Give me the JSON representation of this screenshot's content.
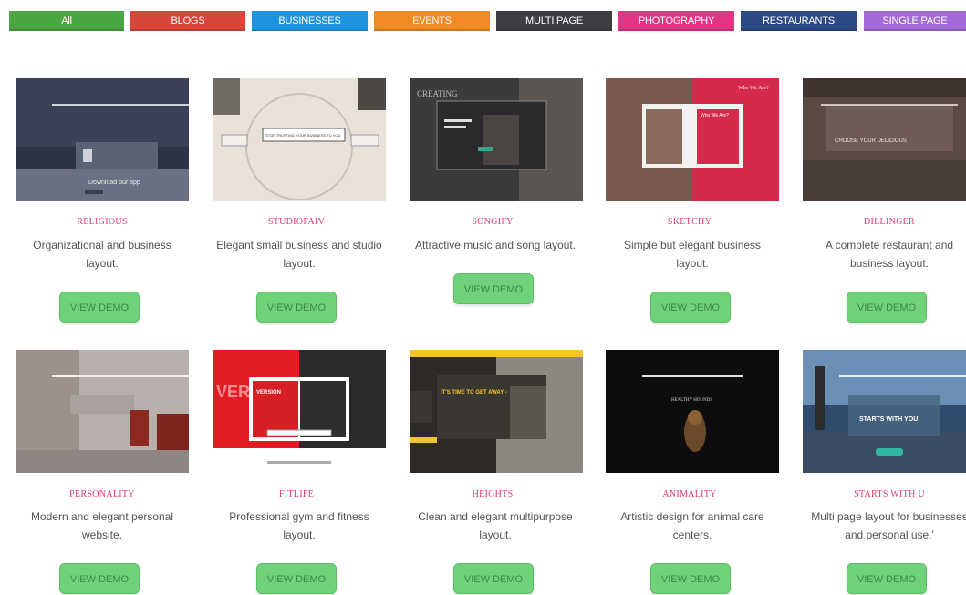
{
  "filters": [
    {
      "label": "All",
      "color": "#49a640"
    },
    {
      "label": "BLOGS",
      "color": "#d9453b"
    },
    {
      "label": "BUSINESSES",
      "color": "#1e93e0"
    },
    {
      "label": "EVENTS",
      "color": "#f08a24"
    },
    {
      "label": "MULTI PAGE",
      "color": "#3e3e42"
    },
    {
      "label": "PHOTOGRAPHY",
      "color": "#e33585"
    },
    {
      "label": "RESTAURANTS",
      "color": "#2d4a86"
    },
    {
      "label": "SINGLE PAGE",
      "color": "#a46ad8"
    }
  ],
  "demo_label": "VIEW DEMO",
  "items": [
    {
      "title": "RELIGIOUS",
      "desc": [
        "Organizational and business",
        "layout."
      ],
      "thumb_text": "Download our app"
    },
    {
      "title": "STUDIOFAIV",
      "desc": [
        "Elegant small business and studio",
        "layout."
      ],
      "thumb_text": "STOP TRUSTING YOUR BUSINESS TO YOU"
    },
    {
      "title": "SONGIFY",
      "desc": [
        "Attractive music and song layout.",
        ""
      ],
      "thumb_text": "CREATING"
    },
    {
      "title": "SKETCHY",
      "desc": [
        "Simple but elegant business",
        "layout."
      ],
      "thumb_text": "Who We Are?"
    },
    {
      "title": "DILLINGER",
      "desc": [
        "A complete restaurant and",
        "business layout."
      ],
      "thumb_text": "CHOOSE YOUR DELICIOUS"
    },
    {
      "title": "PERSONALITY",
      "desc": [
        "Modern and elegant personal",
        "website."
      ],
      "thumb_text": ""
    },
    {
      "title": "FITLIFE",
      "desc": [
        "Professional gym and fitness",
        "layout."
      ],
      "thumb_text": "VERSION"
    },
    {
      "title": "HEIGHTS",
      "desc": [
        "Clean and elegant multipurpose",
        "layout."
      ],
      "thumb_text": "IT'S TIME TO GET AWAY -"
    },
    {
      "title": "ANIMALITY",
      "desc": [
        "Artistic design for animal care",
        "centers."
      ],
      "thumb_text": "HEALTHY HOUNDS"
    },
    {
      "title": "STARTS WITH U",
      "desc": [
        "Multi page layout for businesses",
        "and personal use.'"
      ],
      "thumb_text": "STARTS WITH YOU"
    }
  ]
}
